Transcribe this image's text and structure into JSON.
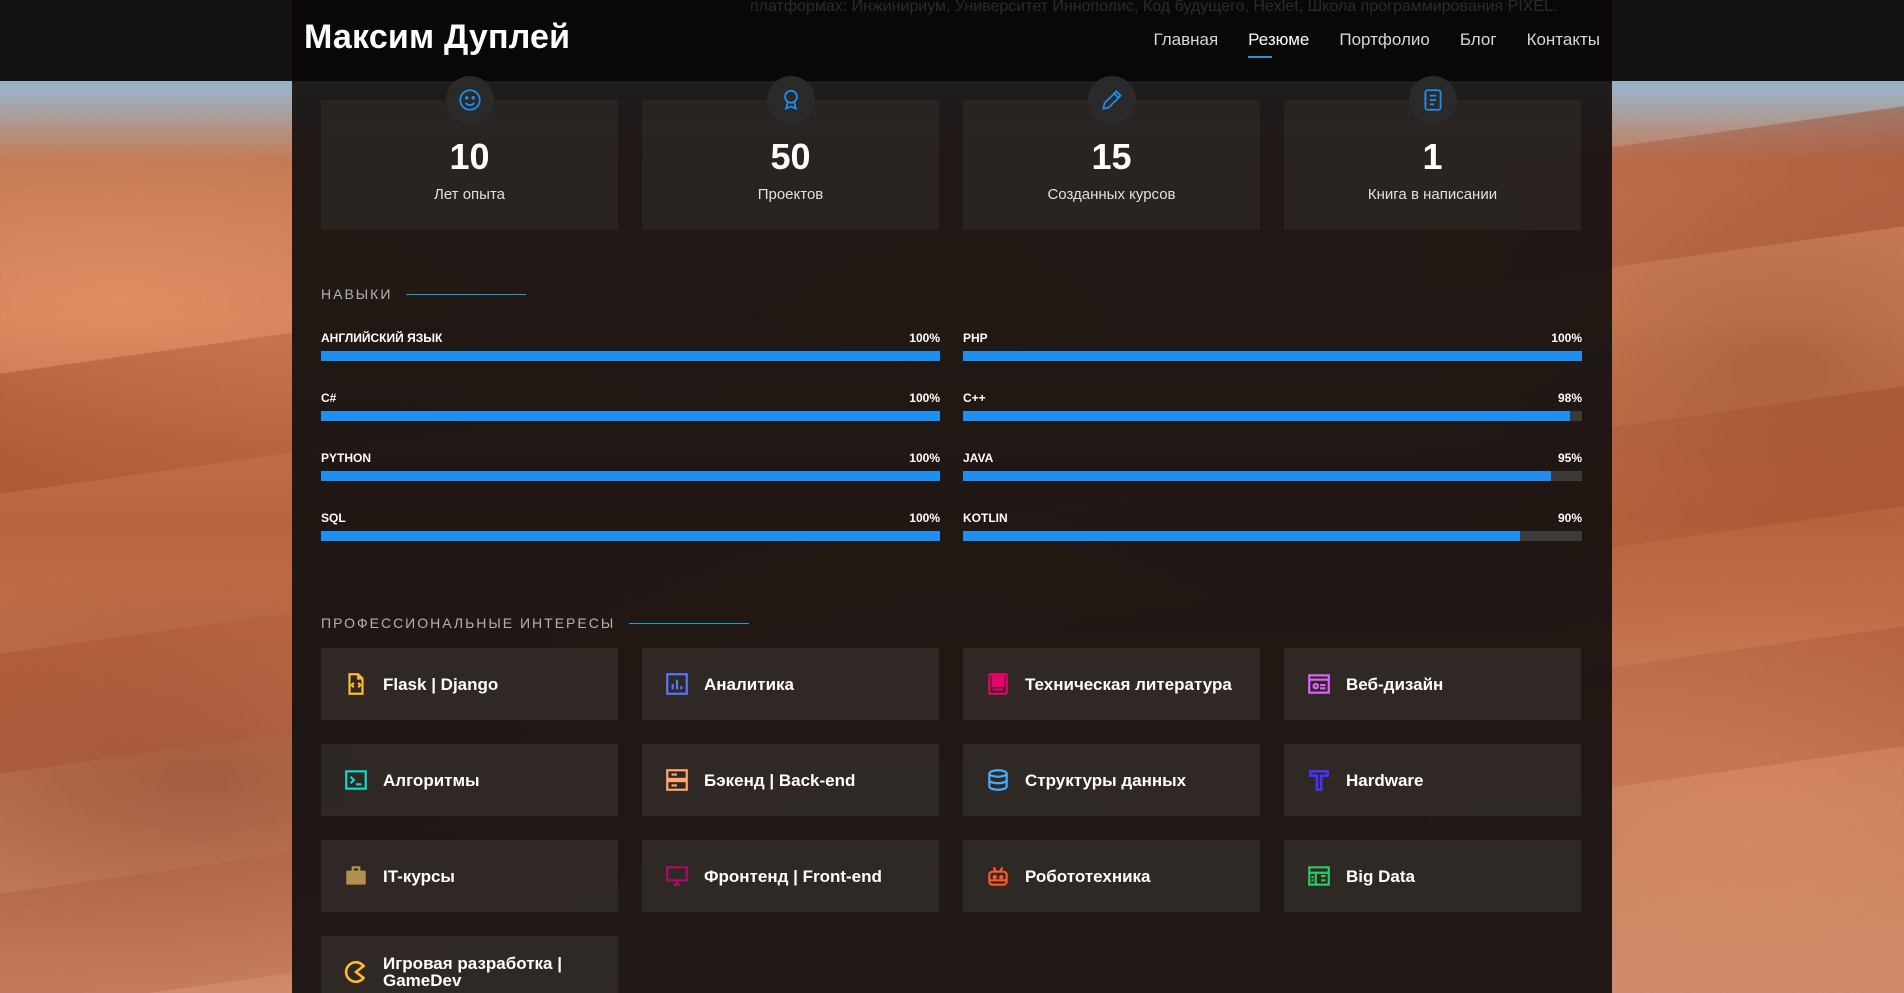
{
  "header": {
    "logo": "Максим Дуплей",
    "ghost_text": "платформах: Инжинириум, Университет Иннополис, Код будущего, Hexlet, Школа программирования PIXEL.",
    "nav": [
      {
        "label": "Главная",
        "active": false
      },
      {
        "label": "Резюме",
        "active": true
      },
      {
        "label": "Портфолио",
        "active": false
      },
      {
        "label": "Блог",
        "active": false
      },
      {
        "label": "Контакты",
        "active": false
      }
    ]
  },
  "counters": [
    {
      "icon": "smile-icon",
      "value": "10",
      "label": "Лет опыта"
    },
    {
      "icon": "award-icon",
      "value": "50",
      "label": "Проектов"
    },
    {
      "icon": "pencil-icon",
      "value": "15",
      "label": "Созданных курсов"
    },
    {
      "icon": "journal-icon",
      "value": "1",
      "label": "Книга в написании"
    }
  ],
  "skills": {
    "title": "НАВЫКИ",
    "left": [
      {
        "name": "АНГЛИЙСКИЙ ЯЗЫК",
        "value": "100%",
        "percent": 100
      },
      {
        "name": "C#",
        "value": "100%",
        "percent": 100
      },
      {
        "name": "PYTHON",
        "value": "100%",
        "percent": 100
      },
      {
        "name": "SQL",
        "value": "100%",
        "percent": 100
      }
    ],
    "right": [
      {
        "name": "PHP",
        "value": "100%",
        "percent": 100
      },
      {
        "name": "C++",
        "value": "98%",
        "percent": 98
      },
      {
        "name": "JAVA",
        "value": "95%",
        "percent": 95
      },
      {
        "name": "KOTLIN",
        "value": "90%",
        "percent": 90
      }
    ]
  },
  "interests": {
    "title": "ПРОФЕССИОНАЛЬНЫЕ ИНТЕРЕСЫ",
    "items": [
      {
        "label": "Flask | Django",
        "icon": "code-file-icon",
        "color": "#ffbb2c"
      },
      {
        "label": "Аналитика",
        "icon": "bar-chart-icon",
        "color": "#5578ff"
      },
      {
        "label": "Техническая литература",
        "icon": "book-icon",
        "color": "#e80368"
      },
      {
        "label": "Веб-дизайн",
        "icon": "web-design-icon",
        "color": "#e361ff"
      },
      {
        "label": "Алгоритмы",
        "icon": "terminal-icon",
        "color": "#47aeff"
      },
      {
        "label": "Бэкенд | Back-end",
        "icon": "server-icon",
        "color": "#ffa76e"
      },
      {
        "label": "Структуры данных",
        "icon": "database-icon",
        "color": "#11dbcf"
      },
      {
        "label": "Hardware",
        "icon": "hardware-icon",
        "color": "#4233ff"
      },
      {
        "label": "IT-курсы",
        "icon": "briefcase-icon",
        "color": "#b2904f"
      },
      {
        "label": "Фронтенд | Front-end",
        "icon": "monitor-icon",
        "color": "#b20969"
      },
      {
        "label": "Робототехника",
        "icon": "robot-icon",
        "color": "#ff5828"
      },
      {
        "label": "Big Data",
        "icon": "spreadsheet-icon",
        "color": "#29cc61"
      },
      {
        "label": "Игровая разработка | GameDev",
        "icon": "pacman-icon",
        "color": "#ffbb2c"
      }
    ]
  },
  "colors": {
    "accent": "#149ddd",
    "bar_fill": "#1e8ff0",
    "bar_track": "#3d3b3a"
  }
}
